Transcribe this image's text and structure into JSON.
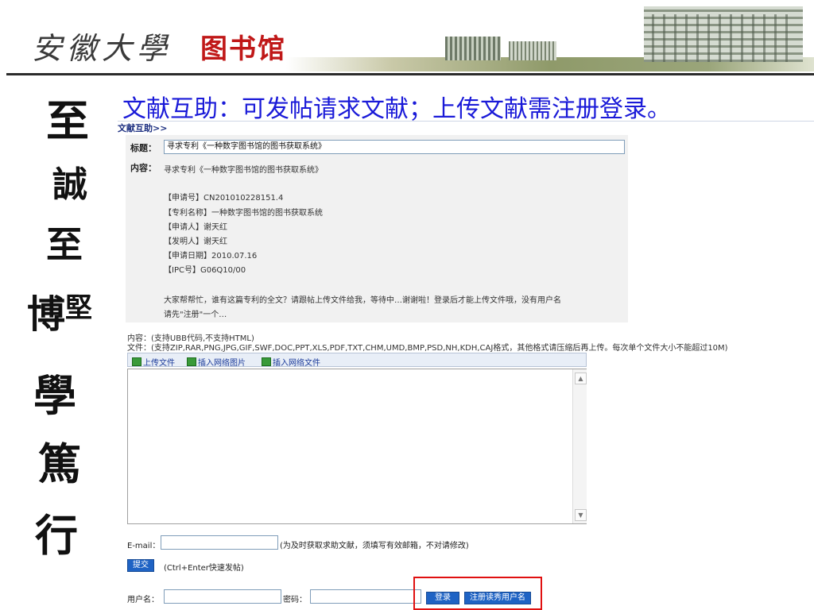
{
  "banner": {
    "school_name": "安徽大學",
    "library_name": "图书馆"
  },
  "motto": [
    "至",
    "誠",
    "至",
    "博",
    "堅",
    "學",
    "篤",
    "行"
  ],
  "headline": "文献互助：可发帖请求文献；上传文献需注册登录。",
  "breadcrumb": "文献互助>>",
  "post": {
    "title_label": "标题：",
    "title_value": "寻求专利《一种数字图书馆的图书获取系统》",
    "content_label": "内容：",
    "content_lines": [
      "寻求专利《一种数字图书馆的图书获取系统》",
      "【申请号】CN201010228151.4",
      "【专利名称】一种数字图书馆的图书获取系统",
      "【申请人】谢天红",
      "【发明人】谢天红",
      "【申请日期】2010.07.16",
      "【IPC号】G06Q10/00",
      "大家帮帮忙，谁有这篇专利的全文？请跟帖上传文件给我，等待中…谢谢啦！登录后才能上传文件哦，没有用户名",
      "请先\"注册\"一个…"
    ]
  },
  "editor": {
    "content_note": "内容：(支持UBB代码,不支持HTML)",
    "file_note": "文件：(支持ZIP,RAR,PNG,JPG,GIF,SWF,DOC,PPT,XLS,PDF,TXT,CHM,UMD,BMP,PSD,NH,KDH,CAJ格式，其他格式请压缩后再上传。每次单个文件大小不能超过10M)",
    "toolbar": {
      "upload": "上传文件",
      "insert_image": "插入网络图片",
      "insert_file": "插入网络文件"
    }
  },
  "form": {
    "email_label": "E-mail：",
    "email_value": "",
    "email_hint": "(为及时获取求助文献，须填写有效邮箱，不对请修改)",
    "submit": "提交",
    "submit_hint": "(Ctrl+Enter快速发帖)",
    "username_label": "用户名：",
    "password_label": "密码：",
    "login": "登录",
    "register": "注册读秀用户名"
  },
  "colors": {
    "headline": "#1a1ad8",
    "button": "#1f63c4",
    "highlight": "#e01010",
    "library_red": "#c01818"
  }
}
